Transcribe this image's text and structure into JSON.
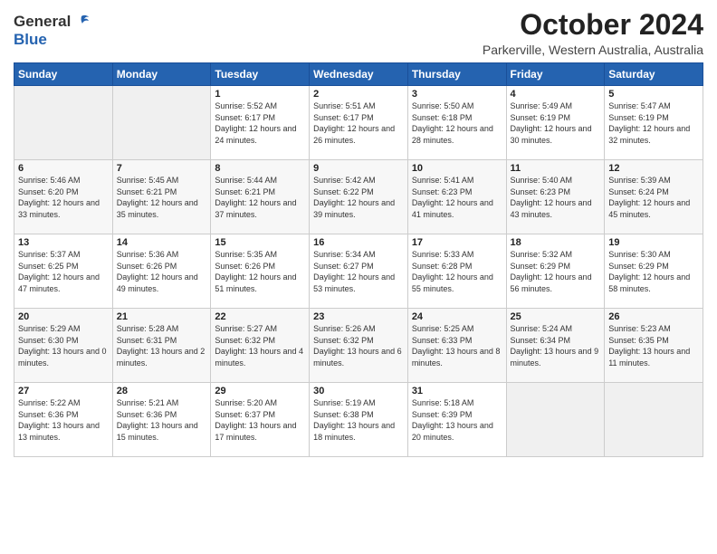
{
  "header": {
    "logo_general": "General",
    "logo_blue": "Blue",
    "month": "October 2024",
    "location": "Parkerville, Western Australia, Australia"
  },
  "weekdays": [
    "Sunday",
    "Monday",
    "Tuesday",
    "Wednesday",
    "Thursday",
    "Friday",
    "Saturday"
  ],
  "weeks": [
    [
      {
        "day": "",
        "sunrise": "",
        "sunset": "",
        "daylight": ""
      },
      {
        "day": "",
        "sunrise": "",
        "sunset": "",
        "daylight": ""
      },
      {
        "day": "1",
        "sunrise": "Sunrise: 5:52 AM",
        "sunset": "Sunset: 6:17 PM",
        "daylight": "Daylight: 12 hours and 24 minutes."
      },
      {
        "day": "2",
        "sunrise": "Sunrise: 5:51 AM",
        "sunset": "Sunset: 6:17 PM",
        "daylight": "Daylight: 12 hours and 26 minutes."
      },
      {
        "day": "3",
        "sunrise": "Sunrise: 5:50 AM",
        "sunset": "Sunset: 6:18 PM",
        "daylight": "Daylight: 12 hours and 28 minutes."
      },
      {
        "day": "4",
        "sunrise": "Sunrise: 5:49 AM",
        "sunset": "Sunset: 6:19 PM",
        "daylight": "Daylight: 12 hours and 30 minutes."
      },
      {
        "day": "5",
        "sunrise": "Sunrise: 5:47 AM",
        "sunset": "Sunset: 6:19 PM",
        "daylight": "Daylight: 12 hours and 32 minutes."
      }
    ],
    [
      {
        "day": "6",
        "sunrise": "Sunrise: 5:46 AM",
        "sunset": "Sunset: 6:20 PM",
        "daylight": "Daylight: 12 hours and 33 minutes."
      },
      {
        "day": "7",
        "sunrise": "Sunrise: 5:45 AM",
        "sunset": "Sunset: 6:21 PM",
        "daylight": "Daylight: 12 hours and 35 minutes."
      },
      {
        "day": "8",
        "sunrise": "Sunrise: 5:44 AM",
        "sunset": "Sunset: 6:21 PM",
        "daylight": "Daylight: 12 hours and 37 minutes."
      },
      {
        "day": "9",
        "sunrise": "Sunrise: 5:42 AM",
        "sunset": "Sunset: 6:22 PM",
        "daylight": "Daylight: 12 hours and 39 minutes."
      },
      {
        "day": "10",
        "sunrise": "Sunrise: 5:41 AM",
        "sunset": "Sunset: 6:23 PM",
        "daylight": "Daylight: 12 hours and 41 minutes."
      },
      {
        "day": "11",
        "sunrise": "Sunrise: 5:40 AM",
        "sunset": "Sunset: 6:23 PM",
        "daylight": "Daylight: 12 hours and 43 minutes."
      },
      {
        "day": "12",
        "sunrise": "Sunrise: 5:39 AM",
        "sunset": "Sunset: 6:24 PM",
        "daylight": "Daylight: 12 hours and 45 minutes."
      }
    ],
    [
      {
        "day": "13",
        "sunrise": "Sunrise: 5:37 AM",
        "sunset": "Sunset: 6:25 PM",
        "daylight": "Daylight: 12 hours and 47 minutes."
      },
      {
        "day": "14",
        "sunrise": "Sunrise: 5:36 AM",
        "sunset": "Sunset: 6:26 PM",
        "daylight": "Daylight: 12 hours and 49 minutes."
      },
      {
        "day": "15",
        "sunrise": "Sunrise: 5:35 AM",
        "sunset": "Sunset: 6:26 PM",
        "daylight": "Daylight: 12 hours and 51 minutes."
      },
      {
        "day": "16",
        "sunrise": "Sunrise: 5:34 AM",
        "sunset": "Sunset: 6:27 PM",
        "daylight": "Daylight: 12 hours and 53 minutes."
      },
      {
        "day": "17",
        "sunrise": "Sunrise: 5:33 AM",
        "sunset": "Sunset: 6:28 PM",
        "daylight": "Daylight: 12 hours and 55 minutes."
      },
      {
        "day": "18",
        "sunrise": "Sunrise: 5:32 AM",
        "sunset": "Sunset: 6:29 PM",
        "daylight": "Daylight: 12 hours and 56 minutes."
      },
      {
        "day": "19",
        "sunrise": "Sunrise: 5:30 AM",
        "sunset": "Sunset: 6:29 PM",
        "daylight": "Daylight: 12 hours and 58 minutes."
      }
    ],
    [
      {
        "day": "20",
        "sunrise": "Sunrise: 5:29 AM",
        "sunset": "Sunset: 6:30 PM",
        "daylight": "Daylight: 13 hours and 0 minutes."
      },
      {
        "day": "21",
        "sunrise": "Sunrise: 5:28 AM",
        "sunset": "Sunset: 6:31 PM",
        "daylight": "Daylight: 13 hours and 2 minutes."
      },
      {
        "day": "22",
        "sunrise": "Sunrise: 5:27 AM",
        "sunset": "Sunset: 6:32 PM",
        "daylight": "Daylight: 13 hours and 4 minutes."
      },
      {
        "day": "23",
        "sunrise": "Sunrise: 5:26 AM",
        "sunset": "Sunset: 6:32 PM",
        "daylight": "Daylight: 13 hours and 6 minutes."
      },
      {
        "day": "24",
        "sunrise": "Sunrise: 5:25 AM",
        "sunset": "Sunset: 6:33 PM",
        "daylight": "Daylight: 13 hours and 8 minutes."
      },
      {
        "day": "25",
        "sunrise": "Sunrise: 5:24 AM",
        "sunset": "Sunset: 6:34 PM",
        "daylight": "Daylight: 13 hours and 9 minutes."
      },
      {
        "day": "26",
        "sunrise": "Sunrise: 5:23 AM",
        "sunset": "Sunset: 6:35 PM",
        "daylight": "Daylight: 13 hours and 11 minutes."
      }
    ],
    [
      {
        "day": "27",
        "sunrise": "Sunrise: 5:22 AM",
        "sunset": "Sunset: 6:36 PM",
        "daylight": "Daylight: 13 hours and 13 minutes."
      },
      {
        "day": "28",
        "sunrise": "Sunrise: 5:21 AM",
        "sunset": "Sunset: 6:36 PM",
        "daylight": "Daylight: 13 hours and 15 minutes."
      },
      {
        "day": "29",
        "sunrise": "Sunrise: 5:20 AM",
        "sunset": "Sunset: 6:37 PM",
        "daylight": "Daylight: 13 hours and 17 minutes."
      },
      {
        "day": "30",
        "sunrise": "Sunrise: 5:19 AM",
        "sunset": "Sunset: 6:38 PM",
        "daylight": "Daylight: 13 hours and 18 minutes."
      },
      {
        "day": "31",
        "sunrise": "Sunrise: 5:18 AM",
        "sunset": "Sunset: 6:39 PM",
        "daylight": "Daylight: 13 hours and 20 minutes."
      },
      {
        "day": "",
        "sunrise": "",
        "sunset": "",
        "daylight": ""
      },
      {
        "day": "",
        "sunrise": "",
        "sunset": "",
        "daylight": ""
      }
    ]
  ]
}
